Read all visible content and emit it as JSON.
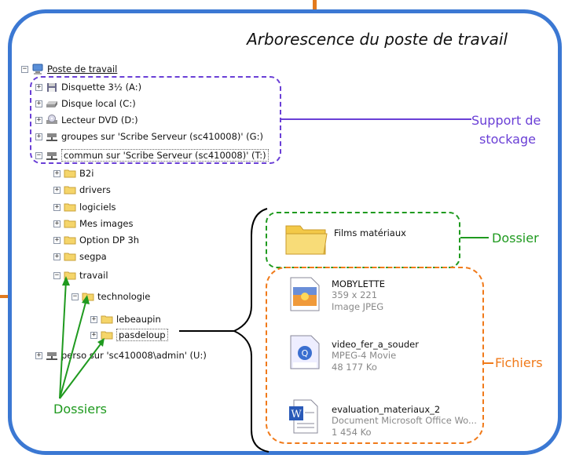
{
  "title": "Arborescence du poste de travail",
  "tree": {
    "root": "Poste de travail",
    "drives": [
      {
        "label": "Disquette 3½ (A:)",
        "icon": "floppy-icon"
      },
      {
        "label": "Disque local (C:)",
        "icon": "hard-disk-icon"
      },
      {
        "label": "Lecteur DVD (D:)",
        "icon": "dvd-drive-icon"
      },
      {
        "label": "groupes sur 'Scribe Serveur (sc410008)' (G:)",
        "icon": "network-drive-icon"
      },
      {
        "label": "commun sur 'Scribe Serveur (sc410008)' (T:)",
        "icon": "network-drive-icon"
      }
    ],
    "folders": [
      "B2i",
      "drivers",
      "logiciels",
      "Mes images",
      "Option DP 3h",
      "segpa",
      "travail"
    ],
    "subfolder": "technologie",
    "subsubfolders": [
      "lebeaupin",
      "pasdeloup"
    ],
    "last_drive": "perso sur 'sc410008\\admin' (U:)"
  },
  "labels": {
    "support_line1": "Support de",
    "support_line2": "stockage",
    "dossier": "Dossier",
    "fichiers": "Fichiers",
    "dossiers": "Dossiers"
  },
  "folder_item": {
    "name": "Films matériaux"
  },
  "files": [
    {
      "name": "MOBYLETTE",
      "meta1": "359 x 221",
      "meta2": "Image JPEG",
      "icon": "jpeg-image-icon"
    },
    {
      "name": "video_fer_a_souder",
      "meta1": "MPEG-4 Movie",
      "meta2": "48 177 Ko",
      "icon": "mpeg4-movie-icon"
    },
    {
      "name": "evaluation_materiaux_2",
      "meta1": "Document Microsoft Office Wo...",
      "meta2": "1 454 Ko",
      "icon": "word-document-icon"
    }
  ],
  "colors": {
    "frame": "#3b78d3",
    "support": "#6a3fd6",
    "dossier": "#1f9a1f",
    "fichiers": "#f07a1a",
    "arrows": "#1f9a1f"
  }
}
